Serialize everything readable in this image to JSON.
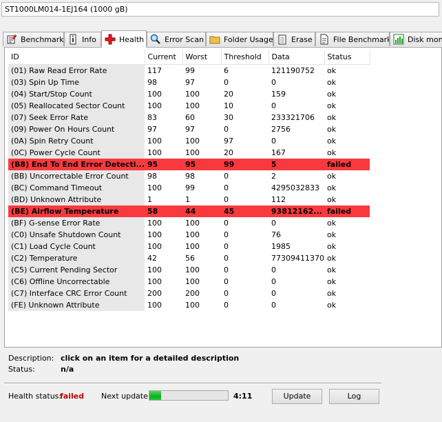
{
  "drive": "ST1000LM014-1EJ164 (1000 gB)",
  "tabs": [
    {
      "label": "Benchmark",
      "icon": "benchmark-icon"
    },
    {
      "label": "Info",
      "icon": "info-icon"
    },
    {
      "label": "Health",
      "icon": "health-cross-icon"
    },
    {
      "label": "Error Scan",
      "icon": "magnifier-icon"
    },
    {
      "label": "Folder Usage",
      "icon": "folder-icon"
    },
    {
      "label": "Erase",
      "icon": "erase-icon"
    },
    {
      "label": "File Benchmark",
      "icon": "file-benchmark-icon"
    },
    {
      "label": "Disk monit",
      "icon": "disk-monitor-icon"
    }
  ],
  "active_tab": "Health",
  "columns": [
    "ID",
    "Current",
    "Worst",
    "Threshold",
    "Data",
    "Status"
  ],
  "rows": [
    {
      "id": "(01) Raw Read Error Rate",
      "current": "117",
      "worst": "99",
      "threshold": "6",
      "data": "121190752",
      "status": "ok"
    },
    {
      "id": "(03) Spin Up Time",
      "current": "98",
      "worst": "97",
      "threshold": "0",
      "data": "0",
      "status": "ok"
    },
    {
      "id": "(04) Start/Stop Count",
      "current": "100",
      "worst": "100",
      "threshold": "20",
      "data": "159",
      "status": "ok"
    },
    {
      "id": "(05) Reallocated Sector Count",
      "current": "100",
      "worst": "100",
      "threshold": "10",
      "data": "0",
      "status": "ok"
    },
    {
      "id": "(07) Seek Error Rate",
      "current": "83",
      "worst": "60",
      "threshold": "30",
      "data": "233321706",
      "status": "ok"
    },
    {
      "id": "(09) Power On Hours Count",
      "current": "97",
      "worst": "97",
      "threshold": "0",
      "data": "2756",
      "status": "ok"
    },
    {
      "id": "(0A) Spin Retry Count",
      "current": "100",
      "worst": "100",
      "threshold": "97",
      "data": "0",
      "status": "ok"
    },
    {
      "id": "(0C) Power Cycle Count",
      "current": "100",
      "worst": "100",
      "threshold": "20",
      "data": "167",
      "status": "ok"
    },
    {
      "id": "(B8) End To End Error Detecti...",
      "current": "95",
      "worst": "95",
      "threshold": "99",
      "data": "5",
      "status": "failed"
    },
    {
      "id": "(BB) Uncorrectable Error Count",
      "current": "98",
      "worst": "98",
      "threshold": "0",
      "data": "2",
      "status": "ok"
    },
    {
      "id": "(BC) Command Timeout",
      "current": "100",
      "worst": "99",
      "threshold": "0",
      "data": "4295032833",
      "status": "ok"
    },
    {
      "id": "(BD) Unknown Attribute",
      "current": "1",
      "worst": "1",
      "threshold": "0",
      "data": "112",
      "status": "ok"
    },
    {
      "id": "(BE) Airflow Temperature",
      "current": "58",
      "worst": "44",
      "threshold": "45",
      "data": "93812162...",
      "status": "failed"
    },
    {
      "id": "(BF) G-sense Error Rate",
      "current": "100",
      "worst": "100",
      "threshold": "0",
      "data": "0",
      "status": "ok"
    },
    {
      "id": "(C0) Unsafe Shutdown Count",
      "current": "100",
      "worst": "100",
      "threshold": "0",
      "data": "76",
      "status": "ok"
    },
    {
      "id": "(C1) Load Cycle Count",
      "current": "100",
      "worst": "100",
      "threshold": "0",
      "data": "1985",
      "status": "ok"
    },
    {
      "id": "(C2) Temperature",
      "current": "42",
      "worst": "56",
      "threshold": "0",
      "data": "77309411370",
      "status": "ok"
    },
    {
      "id": "(C5) Current Pending Sector",
      "current": "100",
      "worst": "100",
      "threshold": "0",
      "data": "0",
      "status": "ok"
    },
    {
      "id": "(C6) Offline Uncorrectable",
      "current": "100",
      "worst": "100",
      "threshold": "0",
      "data": "0",
      "status": "ok"
    },
    {
      "id": "(C7) Interface CRC Error Count",
      "current": "200",
      "worst": "200",
      "threshold": "0",
      "data": "0",
      "status": "ok"
    },
    {
      "id": "(FE) Unknown Attribute",
      "current": "100",
      "worst": "100",
      "threshold": "0",
      "data": "0",
      "status": "ok"
    }
  ],
  "description": {
    "label": "Description:",
    "value": "click on an item for a detailed description",
    "status_label": "Status:",
    "status_value": "n/a"
  },
  "footer": {
    "health_label": "Health status:",
    "health_value": "failed",
    "next_update_label": "Next update:",
    "progress_fraction": 0.15,
    "timer": "4:11",
    "update_button": "Update",
    "log_button": "Log"
  },
  "colors": {
    "failed_row": "#f9393e",
    "failed_text": "#c00000",
    "progress": "#06b025",
    "id_column_bg": "#e8e8e8"
  }
}
